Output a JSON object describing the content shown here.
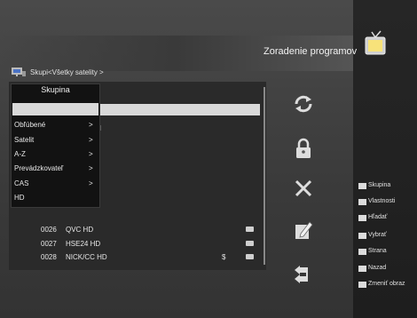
{
  "header": {
    "title": "Zoradenie programov"
  },
  "breadcrumb": {
    "text": "Skupi<Všetky satelity >"
  },
  "group_menu": {
    "header": "Skupina",
    "items": [
      {
        "label": "",
        "arrow": "",
        "selected": true
      },
      {
        "label": "Obľúbené",
        "arrow": ">"
      },
      {
        "label": "Satelit",
        "arrow": ">"
      },
      {
        "label": "A-Z",
        "arrow": ">"
      },
      {
        "label": "Prevádzkovateľ",
        "arrow": ">"
      },
      {
        "label": "CAS",
        "arrow": ">"
      },
      {
        "label": "HD",
        "arrow": ""
      }
    ]
  },
  "list": {
    "partial_text": "l"
  },
  "channels": [
    {
      "number": "0026",
      "name": "QVC HD",
      "flag": ""
    },
    {
      "number": "0027",
      "name": "HSE24 HD",
      "flag": ""
    },
    {
      "number": "0028",
      "name": "NICK/CC HD",
      "flag": "$"
    }
  ],
  "actions": [
    "move-icon",
    "lock-icon",
    "delete-icon",
    "rename-icon",
    "back-icon"
  ],
  "legend": [
    {
      "label": "Skupina",
      "icon": "white-key-icon"
    },
    {
      "label": "Vlastnosti",
      "icon": "white-key-icon"
    },
    {
      "label": "Hľadať",
      "icon": "search-key-icon"
    },
    {
      "label": "Vybrať",
      "icon": "select-key-icon"
    },
    {
      "label": "Strana",
      "icon": "page-key-icon"
    },
    {
      "label": "Nazad",
      "icon": "exit-key-icon"
    },
    {
      "label": "Zmeniť obraz",
      "icon": "switch-key-icon"
    }
  ]
}
